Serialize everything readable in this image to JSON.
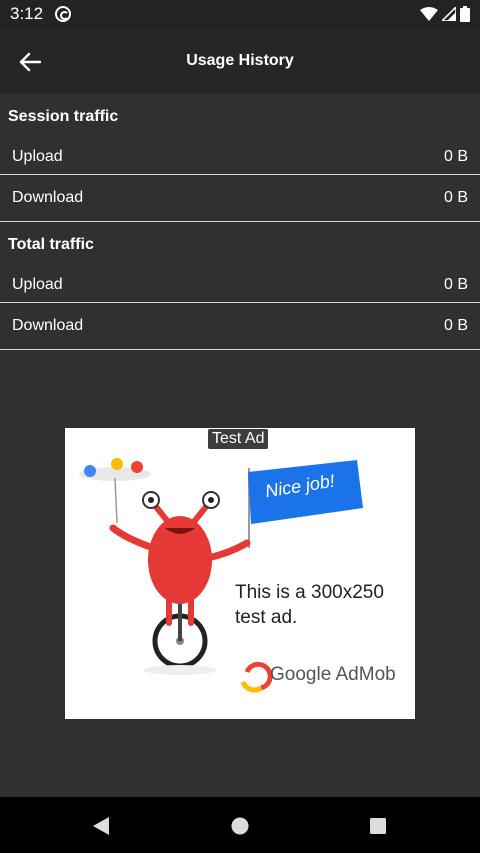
{
  "status_bar": {
    "time": "3:12"
  },
  "app_bar": {
    "title": "Usage History"
  },
  "sections": [
    {
      "header": "Session traffic",
      "rows": [
        {
          "label": "Upload",
          "value": "0 B"
        },
        {
          "label": "Download",
          "value": "0 B"
        }
      ]
    },
    {
      "header": "Total traffic",
      "rows": [
        {
          "label": "Upload",
          "value": "0 B"
        },
        {
          "label": "Download",
          "value": "0 B"
        }
      ]
    }
  ],
  "ad": {
    "badge": "Test Ad",
    "flag_text": "Nice job!",
    "body": "This is a 300x250 test ad.",
    "brand": "Google AdMob"
  },
  "colors": {
    "background": "#303030",
    "app_bar": "#262626",
    "divider": "#d6d6d6",
    "monster": "#e53935",
    "flag": "#1a73e8"
  }
}
